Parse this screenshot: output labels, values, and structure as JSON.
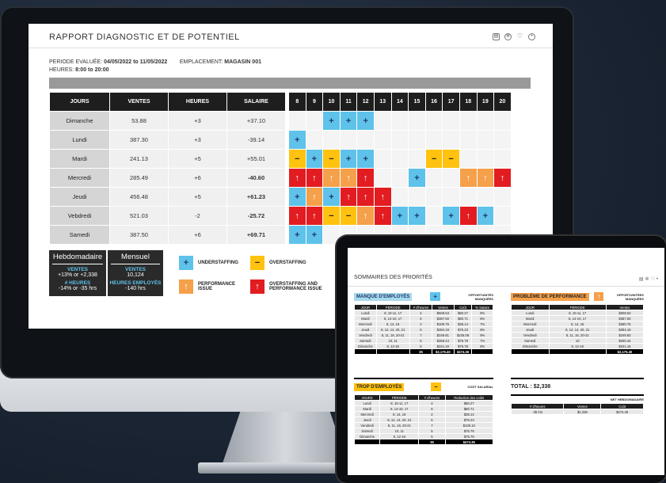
{
  "desktop": {
    "title": "RAPPORT DIAGNOSTIC ET DE POTENTIEL",
    "meta": {
      "period_label": "PERIODE EVALUÉE:",
      "period_value": "04/05/2022 to 11/05/2022",
      "location_label": "EMPLACEMENT:",
      "location_value": "MAGASIN 001",
      "hours_label": "HEURES:",
      "hours_value": "8:00 to 20:00"
    },
    "columns": [
      "JOURS",
      "VENTES",
      "HEURES",
      "SALAIRE"
    ],
    "hours": [
      "8",
      "9",
      "10",
      "11",
      "12",
      "13",
      "14",
      "15",
      "16",
      "17",
      "18",
      "19",
      "20"
    ],
    "rows": [
      {
        "day": "Dimanche",
        "ventes": "53.88",
        "heures": "+3",
        "salaire": "+37.10",
        "cells": [
          "",
          "",
          "u",
          "u",
          "u",
          "",
          "",
          "",
          "",
          "",
          "",
          "",
          ""
        ]
      },
      {
        "day": "Lundi",
        "ventes": "387.30",
        "heures": "+3",
        "salaire": "-39.14",
        "cells": [
          "u",
          "",
          "",
          "",
          "",
          "",
          "",
          "",
          "",
          "",
          "",
          "",
          ""
        ]
      },
      {
        "day": "Mardi",
        "ventes": "241.13",
        "heures": "+5",
        "salaire": "+55.01",
        "cells": [
          "o",
          "u",
          "o",
          "u",
          "u",
          "",
          "",
          "",
          "o",
          "o",
          "",
          "",
          ""
        ]
      },
      {
        "day": "Mercredi",
        "ventes": "285.49",
        "heures": "+6",
        "salaire": "-40.60",
        "cells": [
          "x",
          "x",
          "p",
          "p",
          "x",
          "",
          "",
          "u",
          "",
          "",
          "p",
          "p",
          "x"
        ]
      },
      {
        "day": "Jeudi",
        "ventes": "456.48",
        "heures": "+5",
        "salaire": "+61.23",
        "cells": [
          "u",
          "p",
          "u",
          "x",
          "x",
          "x",
          "",
          "",
          "",
          "",
          "",
          "",
          ""
        ]
      },
      {
        "day": "Vebdredi",
        "ventes": "521.03",
        "heures": "-2",
        "salaire": "-25.72",
        "cells": [
          "x",
          "x",
          "o",
          "o",
          "p",
          "x",
          "u",
          "u",
          "",
          "u",
          "x",
          "u",
          ""
        ]
      },
      {
        "day": "Samedi",
        "ventes": "387.50",
        "heures": "+6",
        "salaire": "+69.71",
        "cells": [
          "u",
          "u",
          "",
          "",
          "",
          "",
          "",
          "",
          "",
          "",
          "",
          "",
          ""
        ]
      }
    ],
    "weekly": {
      "title": "Hebdomadaire",
      "ventes_label": "VENTES",
      "ventes_value": "+13% or +2,338",
      "heures_label": "# HEURES",
      "heures_value": "-14% or -35 hrs"
    },
    "monthly": {
      "title": "Mensuel",
      "ventes_label": "VENTES",
      "ventes_value": "10,124",
      "heures_label": "HEURES EMPLOYÉS",
      "heures_value": "-140 hrs"
    },
    "legend": [
      {
        "key": "u",
        "text": "UNDERSTAFFING"
      },
      {
        "key": "o",
        "text": "OVERSTAFFING"
      },
      {
        "key": "p",
        "text": "PERFORMANCE ISSUE"
      },
      {
        "key": "x",
        "text": "OVERSTAFFING AND PERFORMANCE ISSUE"
      }
    ],
    "colors": {
      "understaffing": "#5ec2ea",
      "overstaffing": "#ffc20e",
      "performance": "#f5a04a",
      "both": "#e21c21"
    }
  },
  "tablet": {
    "title": "SOMMAIRES DES PRIORITÉS",
    "manque": {
      "title": "MANQUE D'EMPLOYÉS",
      "right": "OPPORTUNITÉS MANQUÉES",
      "cols": [
        "JOUR",
        "PÉRIODE",
        "# d'heures",
        "Ventes",
        "Coût",
        "% Salaire"
      ],
      "rows": [
        [
          "Lundi",
          "8, 10-11, 17",
          "4",
          "$508.53",
          "$80.27",
          "8%"
        ],
        [
          "Mardi",
          "8, 14-10, 17",
          "6",
          "$387.50",
          "$80.71",
          "8%"
        ],
        [
          "Mercredi",
          "8, 14, 16",
          "2",
          "$109.75",
          "$38.14",
          "7%"
        ],
        [
          "Jeudi",
          "8, 12, 14, 20, 21",
          "5",
          "$384.19",
          "$75.23",
          "8%"
        ],
        [
          "Vendredi",
          "8, 11, 16, 20-21",
          "7",
          "$249.81",
          "$105.08",
          "9%"
        ],
        [
          "Samedi",
          "10, 11",
          "5",
          "$258.44",
          "$75.78",
          "7%"
        ],
        [
          "Dimanche",
          "8, 12-16",
          "6",
          "$241.15",
          "$75.78",
          "8%"
        ]
      ],
      "total": [
        "",
        "",
        "35",
        "$2,175.40",
        "$474.36",
        ""
      ]
    },
    "trop": {
      "title": "TROP D'EMPLOYÉS",
      "right": "COÛT SALARIAL",
      "cols": [
        "JOURS",
        "PÉRIODE",
        "# d'heures",
        "Reduction des coûts"
      ],
      "rows": [
        [
          "Lundi",
          "8, 10-11, 17",
          "4",
          "$80.27"
        ],
        [
          "Mardi",
          "8, 14-10, 17",
          "8",
          "$80.71"
        ],
        [
          "Mercredi",
          "8, 14, 16",
          "2",
          "$38.14"
        ],
        [
          "Jeudi",
          "8, 12, 14, 20, 21",
          "5",
          "$75.23"
        ],
        [
          "Vendredi",
          "8, 11, 16, 20-21",
          "7",
          "$105.10"
        ],
        [
          "Samedi",
          "10, 11",
          "5",
          "$75.78"
        ],
        [
          "Dimanche",
          "8, 12-16",
          "5",
          "$75.78"
        ]
      ],
      "total": [
        "",
        "",
        "35",
        "$474.36"
      ]
    },
    "perf": {
      "title": "PROBLÈME DE PERFORMANCE",
      "right": "OPPORTUNITÉES MANQUÉES",
      "cols": [
        "JOUR",
        "PÉRIODE",
        "Ventes"
      ],
      "rows": [
        [
          "Lundi",
          "8, 10-11, 17",
          "$508.53"
        ],
        [
          "Mardi",
          "8, 14-10, 17",
          "$387.50"
        ],
        [
          "Mercredi",
          "8, 14, 16",
          "$380.75"
        ],
        [
          "Jeudi",
          "8, 12, 14, 20, 21",
          "$384.19"
        ],
        [
          "Vendredi",
          "8, 11, 16, 20-21",
          "$249.83"
        ],
        [
          "Samedi",
          "10",
          "$250.44"
        ],
        [
          "Dimanche",
          "8, 12-16",
          "$241.15"
        ]
      ],
      "total": [
        "",
        "",
        "$2,175.40"
      ]
    },
    "total": {
      "label": "TOTAL : $2,338",
      "right": "NET HEBDOMADAIRE",
      "cols": [
        "# d'heures",
        "Ventes",
        "Coût"
      ],
      "row": [
        "-35 hrs",
        "$2,338",
        "$474.36"
      ]
    }
  }
}
